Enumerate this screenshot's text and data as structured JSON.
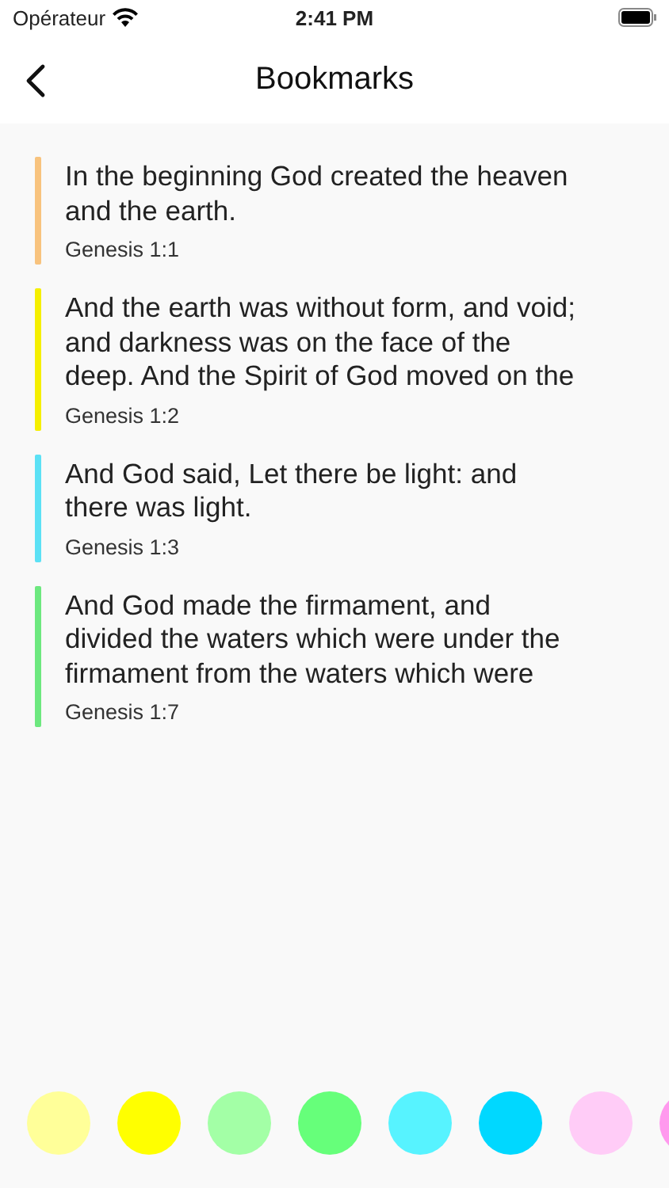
{
  "status_bar": {
    "carrier": "Opérateur",
    "time": "2:41 PM"
  },
  "nav": {
    "title": "Bookmarks"
  },
  "bookmarks": [
    {
      "lines": [
        "In the beginning God created the heaven",
        "and the earth."
      ],
      "reference": "Genesis 1:1",
      "color": "#f8c37e"
    },
    {
      "lines": [
        "And the earth was without form, and void;",
        "and darkness was on the face of the",
        "deep. And the Spirit of God moved on the"
      ],
      "reference": "Genesis 1:2",
      "color": "#f5ef00"
    },
    {
      "lines": [
        "And God said, Let there be light: and",
        "there was light."
      ],
      "reference": "Genesis 1:3",
      "color": "#5ce1f5"
    },
    {
      "lines": [
        "And God made the firmament, and",
        "divided the waters which were under the",
        "firmament from the waters which were"
      ],
      "reference": "Genesis 1:7",
      "color": "#6de87f"
    }
  ],
  "palette": [
    {
      "color": "#ffff99"
    },
    {
      "color": "#ffff00"
    },
    {
      "color": "#a3ffa6"
    },
    {
      "color": "#66ff7a"
    },
    {
      "color": "#57f3ff"
    },
    {
      "color": "#00d8ff"
    },
    {
      "color": "#ffccf7"
    },
    {
      "color": "#ff99ee"
    }
  ]
}
